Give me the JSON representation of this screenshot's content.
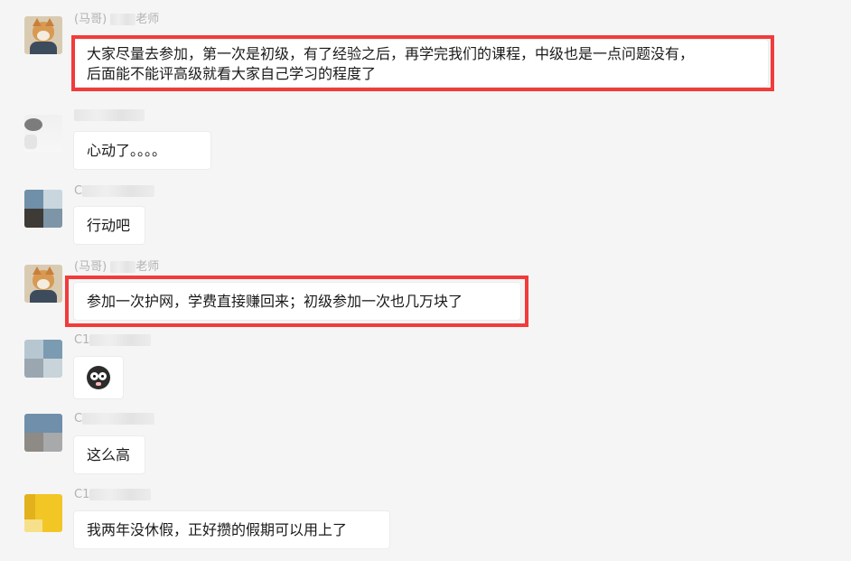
{
  "messages": [
    {
      "sender_prefix": "(马哥)",
      "sender_suffix": "老师",
      "lines": [
        "大家尽量去参加，第一次是初级，有了经验之后，再学完我们的课程，中级也是一点问题没有，",
        "后面能不能评高级就看大家自己学习的程度了"
      ],
      "highlighted": true
    },
    {
      "sender_prefix": "",
      "sender_suffix": "",
      "lines": [
        "心动了。。。。"
      ]
    },
    {
      "sender_prefix": "C",
      "sender_suffix": "",
      "lines": [
        "行动吧"
      ]
    },
    {
      "sender_prefix": "(马哥)",
      "sender_suffix": "老师",
      "lines": [
        "参加一次护网，学费直接赚回来；初级参加一次也几万块了"
      ],
      "highlighted": true
    },
    {
      "sender_prefix": "C1",
      "sender_suffix": "",
      "sticker": "shocked-face-sticker"
    },
    {
      "sender_prefix": "C",
      "sender_suffix": "",
      "lines": [
        "这么高"
      ]
    },
    {
      "sender_prefix": "C1",
      "sender_suffix": "",
      "lines": [
        "我两年没休假，正好攒的假期可以用上了"
      ]
    }
  ],
  "colors": {
    "background": "#f5f5f5",
    "bubble": "#ffffff",
    "highlight": "#f23b3b",
    "name": "#b2b2b2"
  }
}
